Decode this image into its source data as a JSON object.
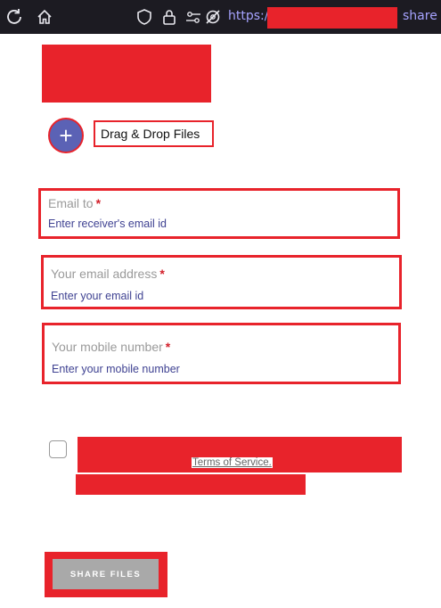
{
  "browser": {
    "url_prefix": "https://",
    "url_suffix": "share",
    "icons": [
      "reload-icon",
      "home-icon",
      "shield-icon",
      "lock-icon",
      "permissions-icon",
      "tracking-off-icon"
    ]
  },
  "upload": {
    "add_icon": "plus-icon",
    "label": "Drag & Drop Files"
  },
  "form": {
    "email_to": {
      "label": "Email to",
      "required": "*",
      "placeholder": "Enter receiver's email id"
    },
    "your_email": {
      "label": "Your email address",
      "required": "*",
      "placeholder": "Enter your email id"
    },
    "mobile": {
      "label": "Your mobile number",
      "required": "*",
      "placeholder": "Enter your mobile number"
    },
    "terms_link": "Terms of Service.",
    "submit_label": "SHARE FILES"
  },
  "colors": {
    "annotation_red": "#e8232b",
    "add_button": "#5b62b5",
    "toolbar_bg": "#1c1b22"
  }
}
